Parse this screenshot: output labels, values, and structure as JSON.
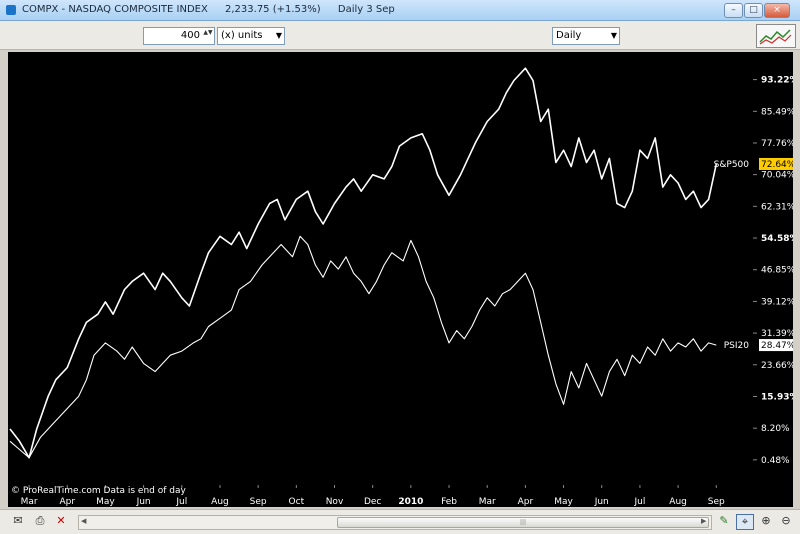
{
  "window": {
    "symbol": "COMPX - NASDAQ COMPOSITE INDEX",
    "last": "2,233.75 (+1.53%)",
    "period": "Daily  3 Sep",
    "btn_min": "–",
    "btn_max": "□",
    "btn_close": "×"
  },
  "toolbar": {
    "units_value": "400",
    "units_label": "(x) units",
    "interval": "Daily",
    "spin_arrows": "▲▼",
    "dropdown_arrow": "▼"
  },
  "bottom": {
    "icons": [
      "envelope-icon",
      "printer-icon",
      "close-x-icon",
      "brush-icon",
      "crosshair-icon",
      "zoom-in-icon",
      "zoom-out-icon"
    ],
    "scroll_left": "◀",
    "scroll_right": "▶",
    "grip": "|||"
  },
  "colors": {
    "background": "#000000",
    "line": "#ffffff",
    "badge_sp500": "#ffcc00",
    "badge_psi20": "#ffffff"
  },
  "chart_data": {
    "type": "line",
    "footer": "© ProRealTime.com  Data is end of day",
    "ylim": [
      -2,
      98
    ],
    "y_ticks": [
      {
        "v": 93.22,
        "label": "93.22%",
        "bold": true
      },
      {
        "v": 85.49,
        "label": "85.49%",
        "bold": false
      },
      {
        "v": 77.76,
        "label": "77.76%",
        "bold": false
      },
      {
        "v": 70.04,
        "label": "70.04%",
        "bold": false
      },
      {
        "v": 62.31,
        "label": "62.31%",
        "bold": false
      },
      {
        "v": 54.58,
        "label": "54.58%",
        "bold": true
      },
      {
        "v": 46.85,
        "label": "46.85%",
        "bold": false
      },
      {
        "v": 39.12,
        "label": "39.12%",
        "bold": false
      },
      {
        "v": 31.39,
        "label": "31.39%",
        "bold": false
      },
      {
        "v": 23.66,
        "label": "23.66%",
        "bold": false
      },
      {
        "v": 15.93,
        "label": "15.93%",
        "bold": true
      },
      {
        "v": 8.2,
        "label": "8.20%",
        "bold": false
      },
      {
        "v": 0.48,
        "label": "0.48%",
        "bold": false
      }
    ],
    "x_ticks": [
      {
        "t": 0.5,
        "label": "Mar",
        "bold": false
      },
      {
        "t": 1.5,
        "label": "Apr",
        "bold": false
      },
      {
        "t": 2.5,
        "label": "May",
        "bold": false
      },
      {
        "t": 3.5,
        "label": "Jun",
        "bold": false
      },
      {
        "t": 4.5,
        "label": "Jul",
        "bold": false
      },
      {
        "t": 5.5,
        "label": "Aug",
        "bold": false
      },
      {
        "t": 6.5,
        "label": "Sep",
        "bold": false
      },
      {
        "t": 7.5,
        "label": "Oct",
        "bold": false
      },
      {
        "t": 8.5,
        "label": "Nov",
        "bold": false
      },
      {
        "t": 9.5,
        "label": "Dec",
        "bold": false
      },
      {
        "t": 10.5,
        "label": "2010",
        "bold": true
      },
      {
        "t": 11.5,
        "label": "Feb",
        "bold": false
      },
      {
        "t": 12.5,
        "label": "Mar",
        "bold": false
      },
      {
        "t": 13.5,
        "label": "Apr",
        "bold": false
      },
      {
        "t": 14.5,
        "label": "May",
        "bold": false
      },
      {
        "t": 15.5,
        "label": "Jun",
        "bold": false
      },
      {
        "t": 16.5,
        "label": "Jul",
        "bold": false
      },
      {
        "t": 17.5,
        "label": "Aug",
        "bold": false
      },
      {
        "t": 18.5,
        "label": "Sep",
        "bold": false
      }
    ],
    "xlim": [
      0,
      19.2
    ],
    "series": [
      {
        "name": "S&P500",
        "last_label": "72.64%",
        "width": 1.6,
        "points": [
          [
            0,
            8
          ],
          [
            0.25,
            5
          ],
          [
            0.5,
            1
          ],
          [
            0.7,
            8
          ],
          [
            1,
            16
          ],
          [
            1.2,
            20
          ],
          [
            1.5,
            23
          ],
          [
            1.8,
            30
          ],
          [
            2,
            34
          ],
          [
            2.3,
            36
          ],
          [
            2.5,
            39
          ],
          [
            2.7,
            36
          ],
          [
            3,
            42
          ],
          [
            3.2,
            44
          ],
          [
            3.5,
            46
          ],
          [
            3.8,
            42
          ],
          [
            4,
            46
          ],
          [
            4.2,
            44
          ],
          [
            4.5,
            40
          ],
          [
            4.7,
            38
          ],
          [
            5,
            46
          ],
          [
            5.2,
            51
          ],
          [
            5.5,
            55
          ],
          [
            5.8,
            53
          ],
          [
            6,
            56
          ],
          [
            6.2,
            52
          ],
          [
            6.5,
            58
          ],
          [
            6.8,
            63
          ],
          [
            7,
            64
          ],
          [
            7.2,
            59
          ],
          [
            7.5,
            64
          ],
          [
            7.8,
            66
          ],
          [
            8,
            61
          ],
          [
            8.2,
            58
          ],
          [
            8.5,
            63
          ],
          [
            8.8,
            67
          ],
          [
            9,
            69
          ],
          [
            9.2,
            66
          ],
          [
            9.5,
            70
          ],
          [
            9.8,
            69
          ],
          [
            10,
            72
          ],
          [
            10.2,
            77
          ],
          [
            10.5,
            79
          ],
          [
            10.8,
            80
          ],
          [
            11,
            76
          ],
          [
            11.2,
            70
          ],
          [
            11.5,
            65
          ],
          [
            11.8,
            70
          ],
          [
            12,
            74
          ],
          [
            12.2,
            78
          ],
          [
            12.5,
            83
          ],
          [
            12.8,
            86
          ],
          [
            13,
            90
          ],
          [
            13.2,
            93
          ],
          [
            13.5,
            96
          ],
          [
            13.7,
            93
          ],
          [
            13.9,
            83
          ],
          [
            14.1,
            86
          ],
          [
            14.3,
            73
          ],
          [
            14.5,
            76
          ],
          [
            14.7,
            72
          ],
          [
            14.9,
            79
          ],
          [
            15.1,
            73
          ],
          [
            15.3,
            76
          ],
          [
            15.5,
            69
          ],
          [
            15.7,
            74
          ],
          [
            15.9,
            63
          ],
          [
            16.1,
            62
          ],
          [
            16.3,
            66
          ],
          [
            16.5,
            76
          ],
          [
            16.7,
            74
          ],
          [
            16.9,
            79
          ],
          [
            17.1,
            67
          ],
          [
            17.3,
            70
          ],
          [
            17.5,
            68
          ],
          [
            17.7,
            64
          ],
          [
            17.9,
            66
          ],
          [
            18.1,
            62
          ],
          [
            18.3,
            64
          ],
          [
            18.5,
            72.64
          ]
        ]
      },
      {
        "name": "PSI20",
        "last_label": "28.47%",
        "width": 1.1,
        "points": [
          [
            0,
            5
          ],
          [
            0.25,
            3
          ],
          [
            0.5,
            1
          ],
          [
            0.8,
            6
          ],
          [
            1.2,
            10
          ],
          [
            1.5,
            13
          ],
          [
            1.8,
            16
          ],
          [
            2,
            20
          ],
          [
            2.2,
            26
          ],
          [
            2.5,
            29
          ],
          [
            2.8,
            27
          ],
          [
            3,
            25
          ],
          [
            3.2,
            28
          ],
          [
            3.5,
            24
          ],
          [
            3.8,
            22
          ],
          [
            4,
            24
          ],
          [
            4.2,
            26
          ],
          [
            4.5,
            27
          ],
          [
            4.8,
            29
          ],
          [
            5,
            30
          ],
          [
            5.2,
            33
          ],
          [
            5.5,
            35
          ],
          [
            5.8,
            37
          ],
          [
            6,
            42
          ],
          [
            6.3,
            44
          ],
          [
            6.6,
            48
          ],
          [
            6.9,
            51
          ],
          [
            7.1,
            53
          ],
          [
            7.4,
            50
          ],
          [
            7.6,
            55
          ],
          [
            7.8,
            53
          ],
          [
            8,
            48
          ],
          [
            8.2,
            45
          ],
          [
            8.4,
            49
          ],
          [
            8.6,
            47
          ],
          [
            8.8,
            50
          ],
          [
            9,
            46
          ],
          [
            9.2,
            44
          ],
          [
            9.4,
            41
          ],
          [
            9.6,
            44
          ],
          [
            9.8,
            48
          ],
          [
            10,
            51
          ],
          [
            10.3,
            49
          ],
          [
            10.5,
            54
          ],
          [
            10.7,
            50
          ],
          [
            10.9,
            44
          ],
          [
            11.1,
            40
          ],
          [
            11.3,
            34
          ],
          [
            11.5,
            29
          ],
          [
            11.7,
            32
          ],
          [
            11.9,
            30
          ],
          [
            12.1,
            33
          ],
          [
            12.3,
            37
          ],
          [
            12.5,
            40
          ],
          [
            12.7,
            38
          ],
          [
            12.9,
            41
          ],
          [
            13.1,
            42
          ],
          [
            13.3,
            44
          ],
          [
            13.5,
            46
          ],
          [
            13.7,
            42
          ],
          [
            13.9,
            34
          ],
          [
            14.1,
            26
          ],
          [
            14.3,
            19
          ],
          [
            14.5,
            14
          ],
          [
            14.7,
            22
          ],
          [
            14.9,
            18
          ],
          [
            15.1,
            24
          ],
          [
            15.3,
            20
          ],
          [
            15.5,
            16
          ],
          [
            15.7,
            22
          ],
          [
            15.9,
            25
          ],
          [
            16.1,
            21
          ],
          [
            16.3,
            26
          ],
          [
            16.5,
            24
          ],
          [
            16.7,
            28
          ],
          [
            16.9,
            26
          ],
          [
            17.1,
            30
          ],
          [
            17.3,
            27
          ],
          [
            17.5,
            29
          ],
          [
            17.7,
            28
          ],
          [
            17.9,
            30
          ],
          [
            18.1,
            27
          ],
          [
            18.3,
            29
          ],
          [
            18.5,
            28.47
          ]
        ]
      }
    ]
  }
}
